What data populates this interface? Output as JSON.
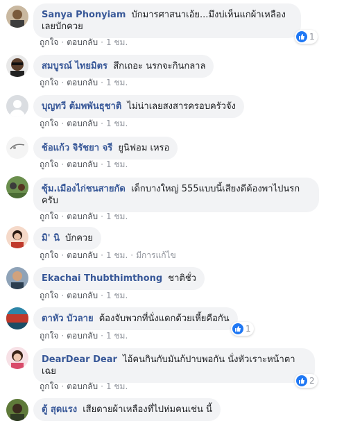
{
  "labels": {
    "like": "ถูกใจ",
    "reply": "ตอบกลับ",
    "dot": "·",
    "edited": "มีการแก้ไข"
  },
  "colors": {
    "name": "#385898",
    "bubble": "#f2f3f5",
    "meta": "#90949c",
    "like": "#2078f4"
  },
  "comments": [
    {
      "name": "Sanya Phonyiam",
      "text": "บักมารศาสนาเอ้ย...มึงบ่เห็นแกผ้าเหลืองเลยบักควย",
      "time": "1 ชม.",
      "reactions": "1"
    },
    {
      "name": "สมบูรณ์ ไทยมิตร",
      "text": "สึกเถอะ นรกจะกินกลาล",
      "time": "1 ชม."
    },
    {
      "name": "บุญทวี ต้มพพันธุชาติ",
      "text": "ไม่น่าเลยสงสารครอบครัวจัง",
      "time": "1 ชม."
    },
    {
      "name": "ช้อแก้ว จิรัชยา จรี",
      "text": "ยูนิฟอม เหรอ",
      "time": "1 ชม."
    },
    {
      "name": "ซุ้ม.เมืองไก่ชนสายกัด",
      "text": "เด็กบางใหญ่ 555แบบนี้เสียงดีต้องพาไปนรกครับ",
      "time": "1 ชม."
    },
    {
      "name": "มิ' นิ",
      "text": "บักควย",
      "time": "1 ชม.",
      "edited": true
    },
    {
      "name": "Ekachai Thubthimthong",
      "text": "ชาติชั่ว",
      "time": "1 ชม."
    },
    {
      "name": "ตาหัว บัวลาย",
      "text": "ต้องจับพวกที่นั่งแดกด้วยเหี้ยคือกัน",
      "time": "1 ชม.",
      "reactions": "1"
    },
    {
      "name": "DearDear Dear",
      "text": "ไอ้คนกินกับมันก้ปาบพอกัน นั่งหัวเราะหน้าตาเฉย",
      "time": "1 ชม.",
      "reactions": "2"
    },
    {
      "name": "ตู้ สุดแรง",
      "text": "เสียดายผ้าเหลืองที่ไปห่มคนเช่น นี้"
    }
  ]
}
